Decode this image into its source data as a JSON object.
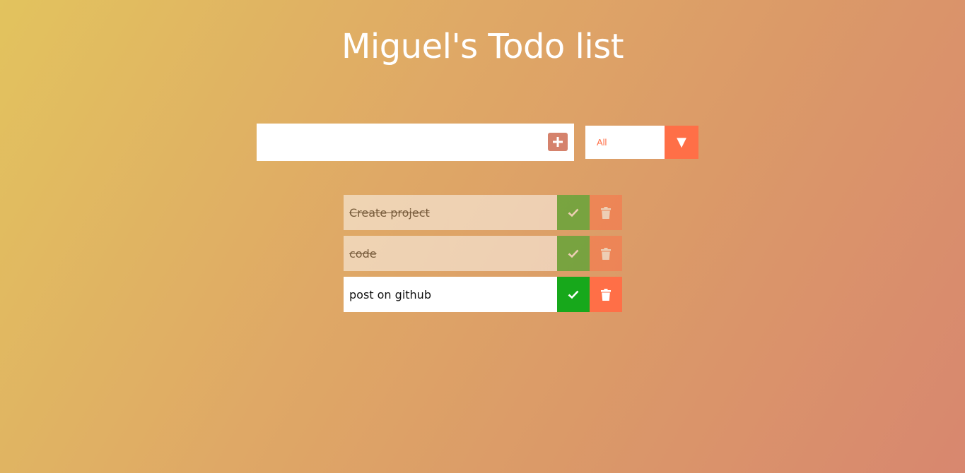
{
  "header": {
    "title": "Miguel's Todo list"
  },
  "form": {
    "input_value": "",
    "input_placeholder": "",
    "add_icon": "plus-icon",
    "filter_selected": "All",
    "filter_arrow_icon": "triangle-down-icon"
  },
  "todos": [
    {
      "text": "Create project",
      "completed": true
    },
    {
      "text": "code",
      "completed": true
    },
    {
      "text": "post on github",
      "completed": false
    }
  ],
  "colors": {
    "accent": "#ff6f47",
    "check": "#17a81b",
    "add_button": "#d5826c",
    "title": "#ffffff"
  }
}
